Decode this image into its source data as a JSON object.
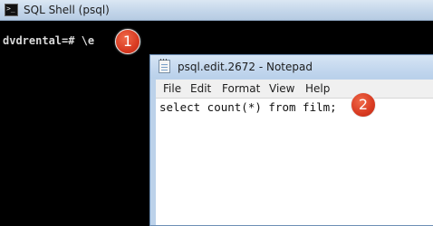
{
  "shell": {
    "title": "SQL Shell (psql)",
    "icon": "terminal-icon",
    "prompt": "dvdrental=# \\e"
  },
  "notepad": {
    "title": "psql.edit.2672 - Notepad",
    "icon": "notepad-icon",
    "menu": [
      "File",
      "Edit",
      "Format",
      "View",
      "Help"
    ],
    "content": "select count(*) from film;"
  },
  "annotations": {
    "step1": "1",
    "step2": "2",
    "color": "#d83a21"
  }
}
